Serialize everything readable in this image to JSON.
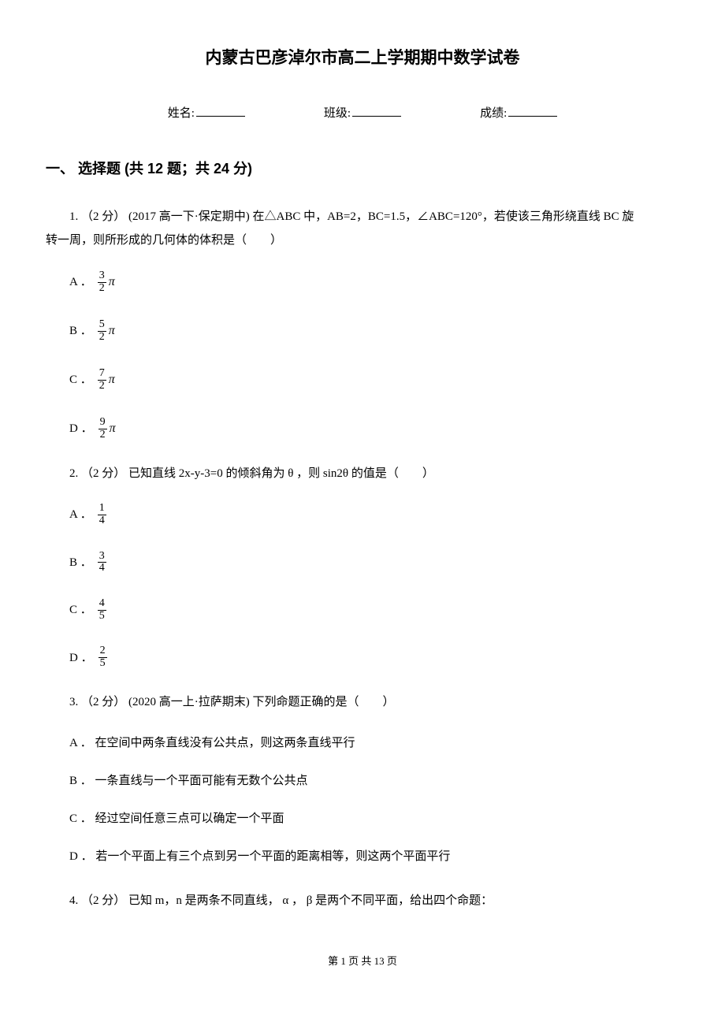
{
  "title": "内蒙古巴彦淖尔市高二上学期期中数学试卷",
  "info": {
    "name_label": "姓名:",
    "class_label": "班级:",
    "score_label": "成绩:"
  },
  "section": {
    "header": "一、 选择题 (共 12 题；共 24 分)"
  },
  "q1": {
    "text_line1": "1. （2 分） (2017 高一下·保定期中) 在△ABC 中，AB=2，BC=1.5，∠ABC=120°，若使该三角形绕直线 BC 旋",
    "text_line2": "转一周，则所形成的几何体的体积是（　　）",
    "opts": {
      "A": {
        "label": "A ．",
        "num": "3",
        "den": "2"
      },
      "B": {
        "label": "B ．",
        "num": "5",
        "den": "2"
      },
      "C": {
        "label": "C ．",
        "num": "7",
        "den": "2"
      },
      "D": {
        "label": "D ．",
        "num": "9",
        "den": "2"
      }
    },
    "pi": "π"
  },
  "q2": {
    "text": "2. （2 分） 已知直线 2x‐y‐3=0 的倾斜角为 θ ，则 sin2θ 的值是（　　）",
    "opts": {
      "A": {
        "label": "A ．",
        "num": "1",
        "den": "4"
      },
      "B": {
        "label": "B ．",
        "num": "3",
        "den": "4"
      },
      "C": {
        "label": "C ．",
        "num": "4",
        "den": "5"
      },
      "D": {
        "label": "D ．",
        "num": "2",
        "den": "5"
      }
    }
  },
  "q3": {
    "text": "3. （2 分） (2020 高一上·拉萨期末) 下列命题正确的是（　　）",
    "opts": {
      "A": "A ． 在空间中两条直线没有公共点，则这两条直线平行",
      "B": "B ． 一条直线与一个平面可能有无数个公共点",
      "C": "C ． 经过空间任意三点可以确定一个平面",
      "D": "D ． 若一个平面上有三个点到另一个平面的距离相等，则这两个平面平行"
    }
  },
  "q4": {
    "text": "4. （2 分） 已知 m，n 是两条不同直线， α ， β 是两个不同平面，给出四个命题："
  },
  "footer": "第 1 页 共 13 页"
}
